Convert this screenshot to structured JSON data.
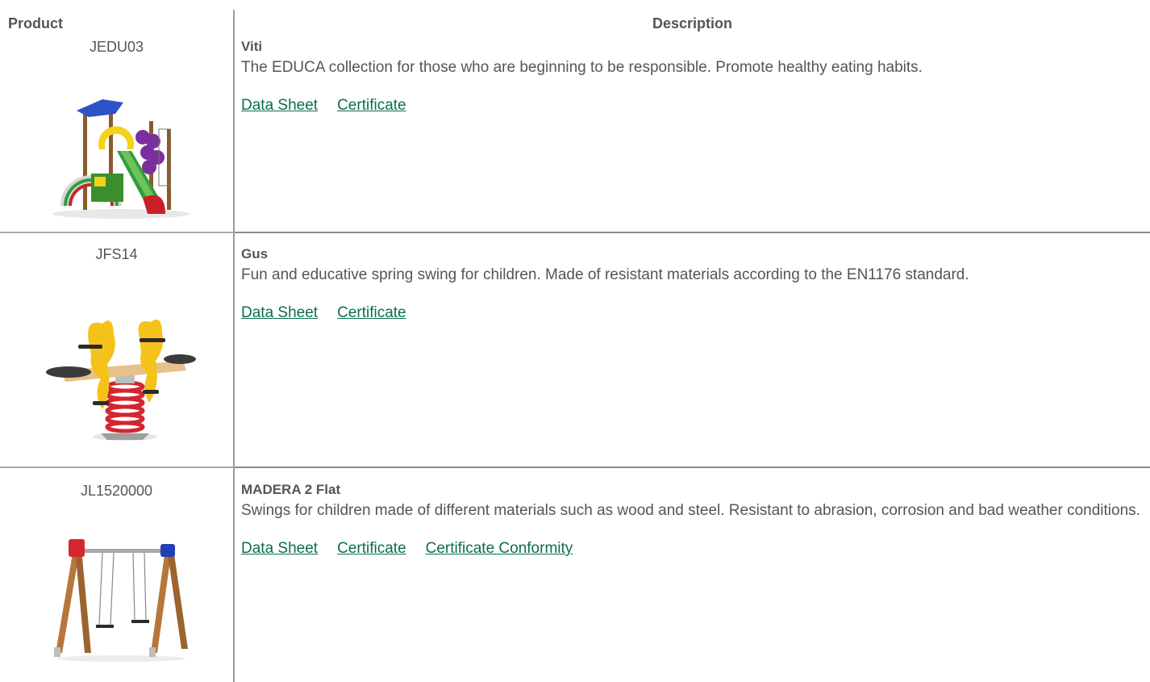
{
  "table": {
    "headers": {
      "product": "Product",
      "description": "Description"
    },
    "rows": [
      {
        "code": "JEDU03",
        "image_icon": "play-structure-slide-image",
        "name": "Viti",
        "text": "The EDUCA collection for those who are beginning to be responsible. Promote healthy eating habits.",
        "links": [
          "Data Sheet",
          "Certificate"
        ]
      },
      {
        "code": "JFS14",
        "image_icon": "spring-seesaw-image",
        "name": "Gus",
        "text": "Fun and educative spring swing for children. Made of resistant materials according to the EN1176 standard.",
        "links": [
          "Data Sheet",
          "Certificate"
        ]
      },
      {
        "code": "JL1520000",
        "image_icon": "wooden-swing-set-image",
        "name": "MADERA 2 Flat",
        "text": "Swings for children made of different materials such as wood and steel. Resistant to abrasion, corrosion and bad weather conditions.",
        "links": [
          "Data Sheet",
          "Certificate",
          "Certificate Conformity"
        ]
      }
    ]
  },
  "colors": {
    "text": "#555555",
    "link": "#0b6e4f",
    "divider": "#9a9a9a"
  }
}
